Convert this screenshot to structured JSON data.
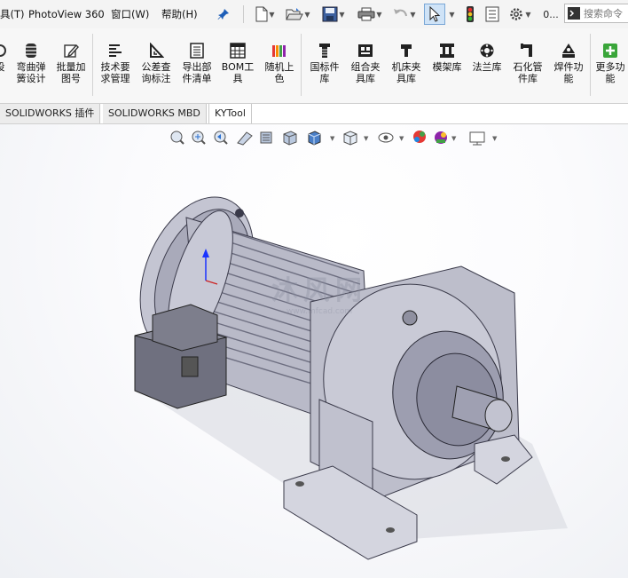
{
  "menu": {
    "tools_partial": "具(T)",
    "photoview": "PhotoView 360",
    "window": "窗口(W)",
    "help": "帮助(H)"
  },
  "quick_access": {
    "more": "0..."
  },
  "search": {
    "placeholder": "搜索命令"
  },
  "ribbon": {
    "items": [
      {
        "label": "设",
        "icon": "gear-partial-icon"
      },
      {
        "label": "弯曲弹\n簧设计",
        "icon": "spring-icon"
      },
      {
        "label": "批量加\n图号",
        "icon": "pencil-edit-icon"
      },
      {
        "label": "技术要\n求管理",
        "icon": "text-lines-icon"
      },
      {
        "label": "公差查\n询标注",
        "icon": "tolerance-triangle-icon"
      },
      {
        "label": "导出部\n件清单",
        "icon": "export-list-icon"
      },
      {
        "label": "BOM工\n具",
        "icon": "bom-table-icon"
      },
      {
        "label": "随机上\n色",
        "icon": "color-bars-icon"
      },
      {
        "label": "国标件\n库",
        "icon": "screw-icon"
      },
      {
        "label": "组合夹\n具库",
        "icon": "fixture-icon"
      },
      {
        "label": "机床夹\n具库",
        "icon": "clamp-icon"
      },
      {
        "label": "模架库",
        "icon": "mold-base-icon"
      },
      {
        "label": "法兰库",
        "icon": "flange-icon"
      },
      {
        "label": "石化管\n件库",
        "icon": "pipe-fitting-icon"
      },
      {
        "label": "焊件功\n能",
        "icon": "weldment-icon"
      },
      {
        "label": "更多功\n能",
        "icon": "plus-icon"
      }
    ]
  },
  "tabs": [
    {
      "label": "SOLIDWORKS 插件",
      "active": false
    },
    {
      "label": "SOLIDWORKS MBD",
      "active": false
    },
    {
      "label": "KYTool",
      "active": true
    }
  ],
  "watermark": {
    "text": "沐风网",
    "url": "www.mfcad.com"
  },
  "colors": {
    "accent_green": "#3aa63a",
    "model_body": "#b9bac8",
    "triad_blue": "#1a33ff"
  }
}
